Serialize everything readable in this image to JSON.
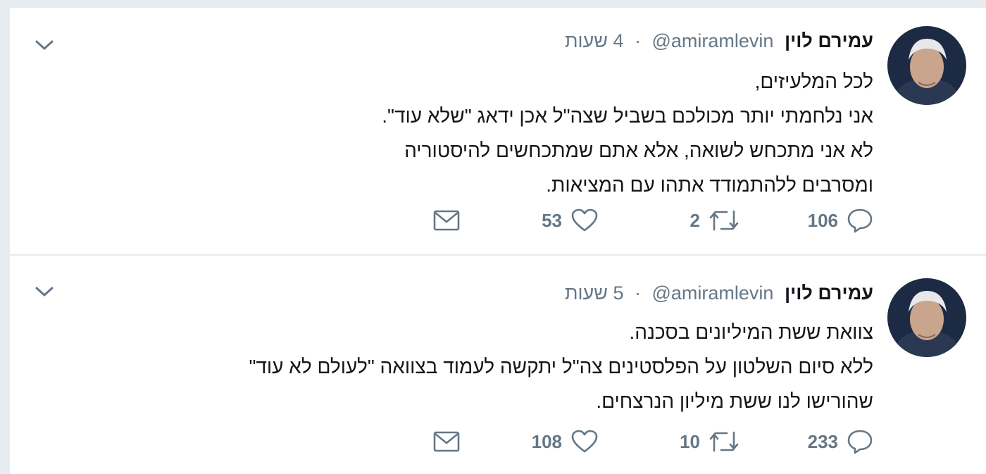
{
  "tweets": [
    {
      "author_name": "עמירם לוין",
      "handle": "@amiramlevin",
      "separator": "·",
      "time": "4 שעות",
      "lines": [
        "לכל המלעיזים,",
        "אני נלחמתי יותר מכולכם בשביל שצה\"ל אכן ידאג \"שלא עוד\".",
        "לא אני מתכחש לשואה, אלא אתם שמתכחשים להיסטוריה",
        "ומסרבים ללהתמודד אתהו עם המציאות."
      ],
      "reply_count": "106",
      "retweet_count": "2",
      "like_count": "53"
    },
    {
      "author_name": "עמירם לוין",
      "handle": "@amiramlevin",
      "separator": "·",
      "time": "5 שעות",
      "lines": [
        "צוואת ששת המיליונים בסכנה.",
        "ללא סיום השלטון על הפלסטינים צה\"ל יתקשה לעמוד בצוואה \"לעולם לא עוד\"",
        "שהורישו לנו ששת מיליון הנרצחים."
      ],
      "reply_count": "233",
      "retweet_count": "10",
      "like_count": "108"
    }
  ],
  "icons": {
    "reply": "reply-icon",
    "retweet": "retweet-icon",
    "like": "heart-icon",
    "dm": "envelope-icon",
    "caret": "chevron-down-icon"
  },
  "colors": {
    "secondary_text": "#657786",
    "primary_text": "#14171a",
    "background": "#e6ecf0"
  }
}
